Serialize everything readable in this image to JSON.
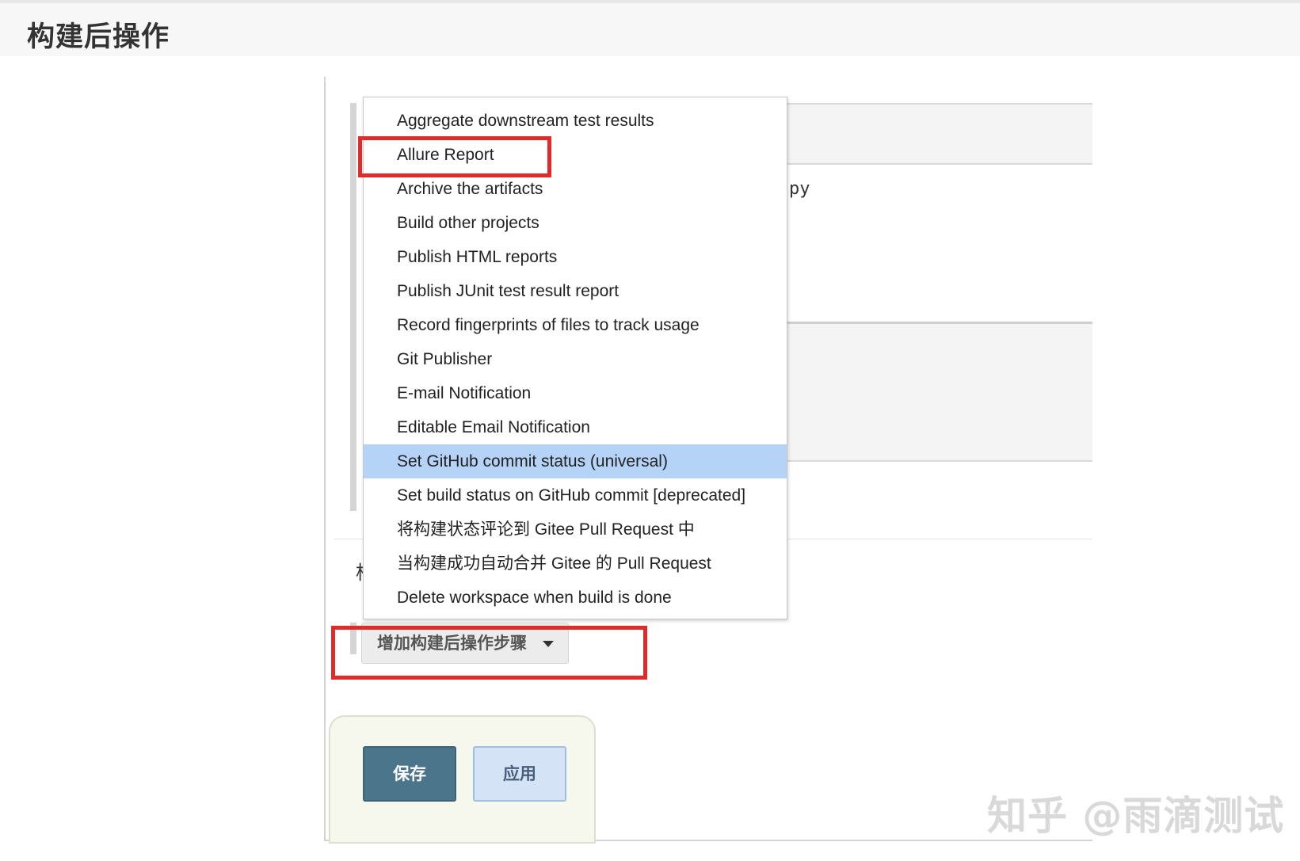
{
  "section": {
    "title": "构建后操作"
  },
  "background": {
    "partial_char": "构",
    "mono_fragment": "py"
  },
  "dropdown": {
    "items": [
      "Aggregate downstream test results",
      "Allure Report",
      "Archive the artifacts",
      "Build other projects",
      "Publish HTML reports",
      "Publish JUnit test result report",
      "Record fingerprints of files to track usage",
      "Git Publisher",
      "E-mail Notification",
      "Editable Email Notification",
      "Set GitHub commit status (universal)",
      "Set build status on GitHub commit [deprecated]",
      "将构建状态评论到 Gitee Pull Request 中",
      "当构建成功自动合并 Gitee 的 Pull Request",
      "Delete workspace when build is done"
    ],
    "highlighted_index": 10
  },
  "add_step": {
    "label": "增加构建后操作步骤",
    "icon": "caret-down-icon"
  },
  "actions": {
    "save_label": "保存",
    "apply_label": "应用"
  },
  "watermark": {
    "text": "知乎 @雨滴测试"
  },
  "colors": {
    "highlight": "#b5d2f7",
    "annotation_red": "#e02b2b",
    "save_bg": "#4b758b",
    "apply_bg": "#d4e3f5"
  }
}
